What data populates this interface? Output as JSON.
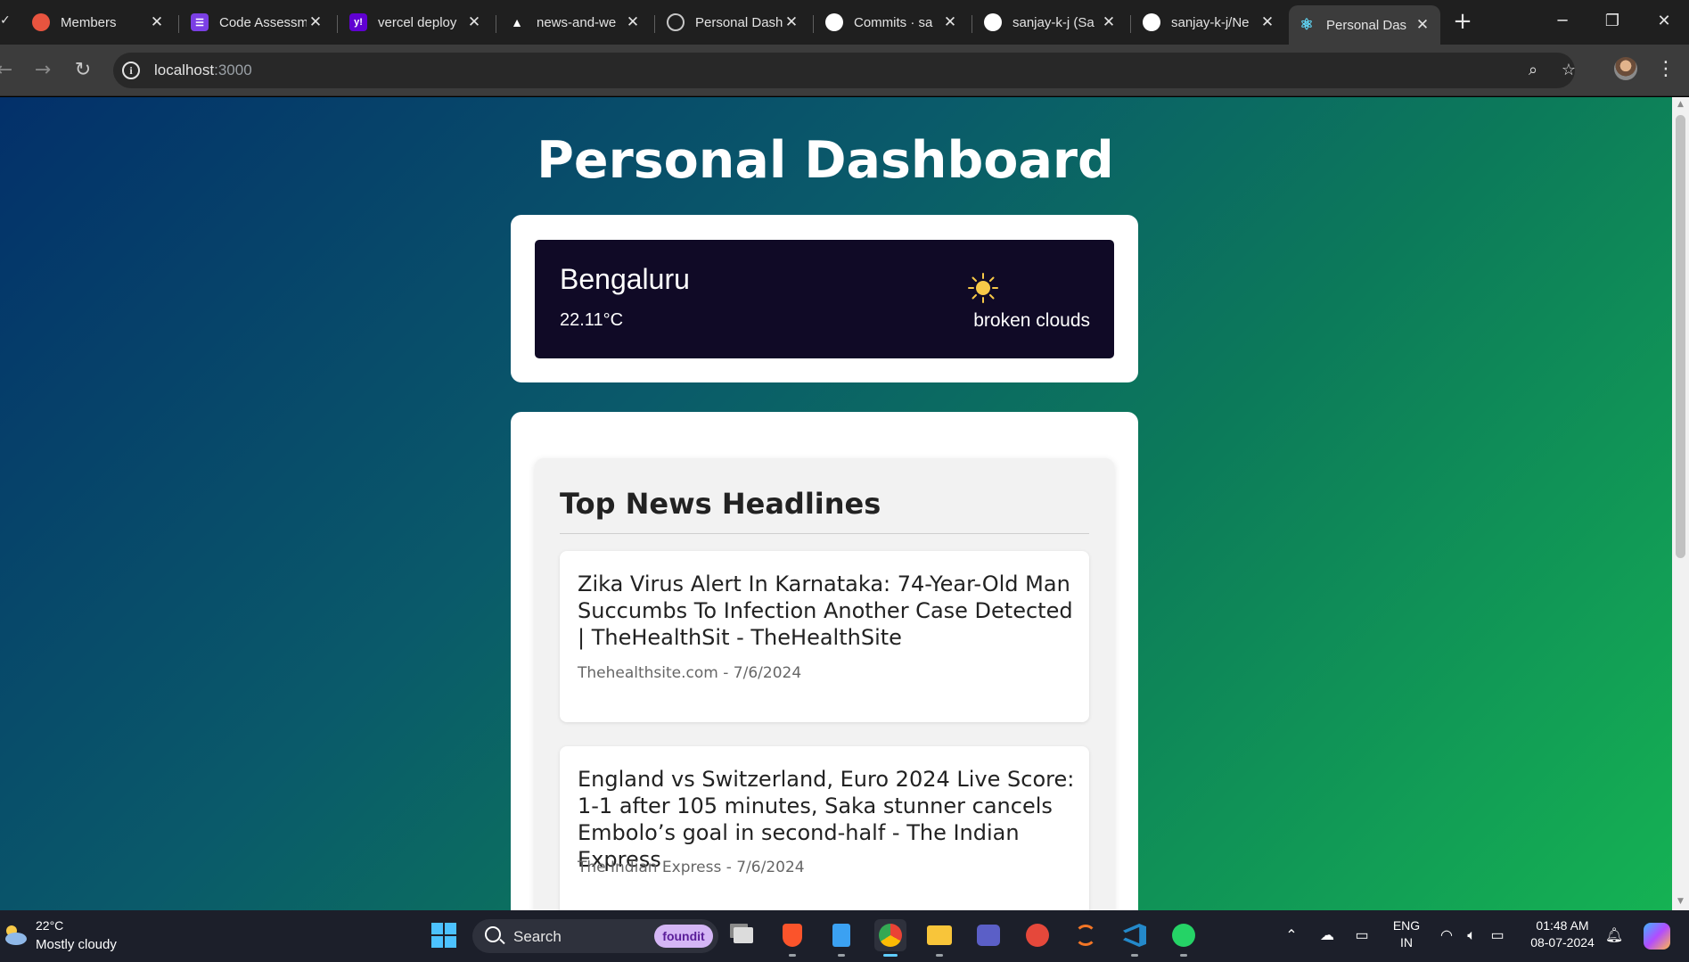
{
  "browser": {
    "tabs": [
      {
        "title": "Members",
        "favicon": "red-mascot-icon",
        "color": "#e8543f"
      },
      {
        "title": "Code Assessm",
        "favicon": "form-list-icon",
        "color": "#7b3fe4"
      },
      {
        "title": "vercel deploy",
        "favicon": "yahoo-icon",
        "color": "#6001d2"
      },
      {
        "title": "news-and-we",
        "favicon": "vercel-triangle-icon",
        "color": "#ffffff"
      },
      {
        "title": "Personal Dash",
        "favicon": "globe-icon",
        "color": "#c7c7c7"
      },
      {
        "title": "Commits · sa",
        "favicon": "github-icon",
        "color": "#ffffff"
      },
      {
        "title": "sanjay-k-j (Sa",
        "favicon": "github-icon",
        "color": "#ffffff"
      },
      {
        "title": "sanjay-k-j/Ne",
        "favicon": "github-icon",
        "color": "#ffffff"
      },
      {
        "title": "Personal Das",
        "favicon": "react-icon",
        "color": "#61dafb",
        "active": true
      }
    ],
    "new_tab": "+",
    "close_glyph": "✕",
    "url": {
      "host": "localhost",
      "port": ":3000"
    }
  },
  "page": {
    "title": "Personal Dashboard",
    "weather": {
      "city": "Bengaluru",
      "temperature": "22.11°C",
      "description": "broken clouds",
      "icon": "sun-icon"
    },
    "news": {
      "heading": "Top News Headlines",
      "articles": [
        {
          "title": "Zika Virus Alert In Karnataka: 74-Year-Old Man Succumbs To Infection Another Case Detected | TheHealthSit - TheHealthSite",
          "meta": "Thehealthsite.com - 7/6/2024"
        },
        {
          "title": "England vs Switzerland, Euro 2024 Live Score: 1-1 after 105 minutes, Saka stunner cancels Embolo’s goal in second-half - The Indian Express",
          "meta": "The Indian Express - 7/6/2024"
        }
      ]
    }
  },
  "taskbar": {
    "weather": {
      "temp": "22°C",
      "condition": "Mostly cloudy"
    },
    "search_placeholder": "Search",
    "search_badge": "foundit",
    "language": {
      "lang": "ENG",
      "region": "IN"
    },
    "clock": {
      "time": "01:48 AM",
      "date": "08-07-2024"
    }
  },
  "colors": {
    "accent_bg_dark": "#100a26",
    "gradient_start": "#03306a",
    "gradient_end": "#15b253"
  }
}
